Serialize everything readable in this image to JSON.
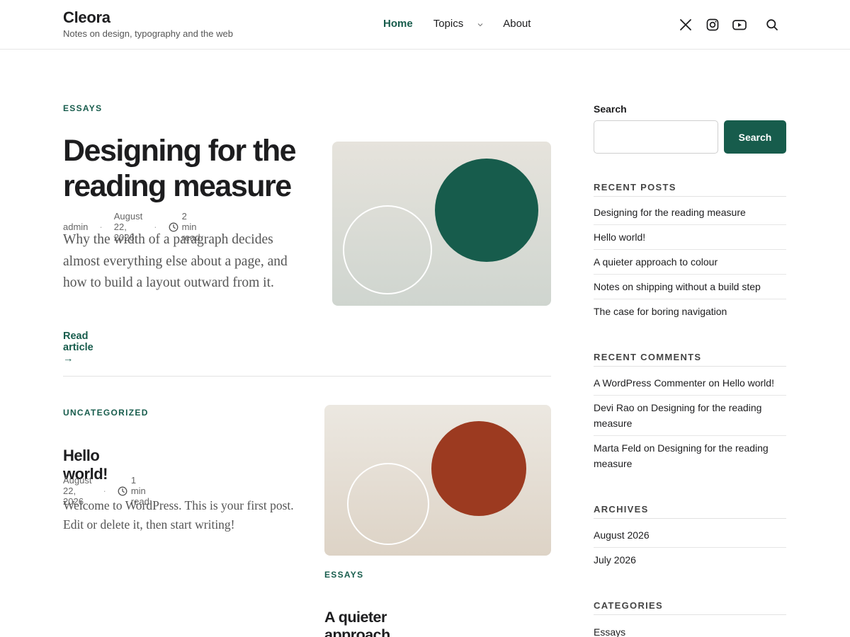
{
  "site": {
    "title": "Cleora",
    "tagline": "Notes on design, typography and the web"
  },
  "nav": {
    "items": [
      {
        "label": "Home",
        "active": true
      },
      {
        "label": "Topics",
        "has_dropdown": true
      },
      {
        "label": "About"
      }
    ]
  },
  "header_icons": [
    "x-icon",
    "instagram-icon",
    "youtube-icon",
    "search-icon"
  ],
  "posts": [
    {
      "category": "ESSAYS",
      "title": "Designing for the reading measure",
      "author": "admin",
      "date": "August 22, 2026",
      "read_time": "2 min read",
      "excerpt": "Why the width of a paragraph decides almost everything else about a page, and how to build a layout outward from it.",
      "read_more": "Read article →",
      "accent_color": "#175c4c"
    },
    {
      "category": "UNCATEGORIZED",
      "title": "Hello world!",
      "date": "August 22, 2026",
      "read_time": "1 min read",
      "excerpt": "Welcome to WordPress. This is your first post. Edit or delete it, then start writing!"
    },
    {
      "category": "ESSAYS",
      "title": "A quieter approach to colour",
      "accent_color": "#9c3a20"
    }
  ],
  "sidebar": {
    "search_label": "Search",
    "search_value": "",
    "search_button": "Search",
    "recent_posts_heading": "RECENT POSTS",
    "recent_posts": [
      "Designing for the reading measure",
      "Hello world!",
      "A quieter approach to colour",
      "Notes on shipping without a build step",
      "The case for boring navigation"
    ],
    "recent_comments_heading": "RECENT COMMENTS",
    "recent_comments": [
      {
        "author": "A WordPress Commenter",
        "on": "on",
        "post": "Hello world!"
      },
      {
        "author": "Devi Rao",
        "on": "on",
        "post": "Designing for the reading measure"
      },
      {
        "author": "Marta Feld",
        "on": "on",
        "post": "Designing for the reading measure"
      }
    ],
    "archives_heading": "ARCHIVES",
    "archives": [
      "August 2026",
      "July 2026"
    ],
    "categories_heading": "CATEGORIES",
    "categories": [
      "Essays"
    ]
  },
  "colors": {
    "brand": "#175c4c",
    "text": "#1d1d1f",
    "muted": "#666666",
    "rust": "#9c3a20"
  }
}
